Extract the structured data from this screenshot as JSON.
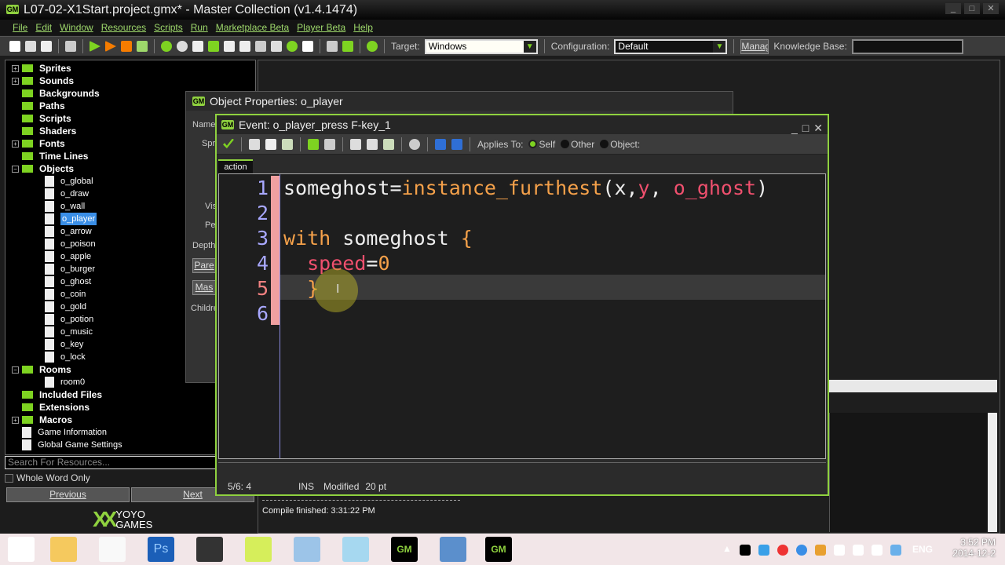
{
  "window": {
    "title": "L07-02-X1Start.project.gmx*  -  Master Collection (v1.4.1474)",
    "controls": [
      "_",
      "□",
      "✕"
    ]
  },
  "menu": [
    "File",
    "Edit",
    "Window",
    "Resources",
    "Scripts",
    "Run",
    "Marketplace Beta",
    "Player Beta",
    "Help"
  ],
  "toolbar": {
    "target_label": "Target:",
    "target_value": "Windows",
    "config_label": "Configuration:",
    "config_value": "Default",
    "manage_label": "Manag",
    "kb_label": "Knowledge Base:",
    "kb_value": ""
  },
  "tree": [
    {
      "label": "Sprites",
      "expand": "+"
    },
    {
      "label": "Sounds",
      "expand": "+"
    },
    {
      "label": "Backgrounds"
    },
    {
      "label": "Paths"
    },
    {
      "label": "Scripts"
    },
    {
      "label": "Shaders"
    },
    {
      "label": "Fonts",
      "expand": "+"
    },
    {
      "label": "Time Lines"
    },
    {
      "label": "Objects",
      "expand": "−",
      "children": [
        "o_global",
        "o_draw",
        "o_wall",
        "o_player",
        "o_arrow",
        "o_poison",
        "o_apple",
        "o_burger",
        "o_ghost",
        "o_coin",
        "o_gold",
        "o_potion",
        "o_music",
        "o_key",
        "o_lock"
      ],
      "selected": "o_player"
    },
    {
      "label": "Rooms",
      "expand": "−",
      "children": [
        "room0"
      ]
    },
    {
      "label": "Included Files"
    },
    {
      "label": "Extensions"
    },
    {
      "label": "Macros",
      "expand": "+"
    }
  ],
  "tree_leaves": [
    "Game Information",
    "Global Game Settings"
  ],
  "search": {
    "placeholder": "Search For Resources..."
  },
  "whole_word": "Whole Word Only",
  "nav": {
    "previous": "Previous",
    "next": "Next"
  },
  "logo": {
    "line1": "YOYO",
    "line2": "GAMES"
  },
  "object_props": {
    "title": "Object Properties: o_player",
    "labels": [
      "Name",
      "Spr",
      "Vis",
      "Pe",
      "Depth",
      "Pare",
      "Mas",
      "Childre"
    ]
  },
  "event": {
    "title": "Event: o_player_press F-key_1",
    "applies_to": "Applies To:",
    "self": "Self",
    "other": "Other",
    "object": "Object:",
    "tab": "action",
    "lines": [
      [
        {
          "t": "someghost=",
          "c": ""
        },
        {
          "t": "instance_furthest",
          "c": "fn"
        },
        {
          "t": "(x,",
          "c": ""
        },
        {
          "t": "y",
          "c": "var"
        },
        {
          "t": ", ",
          "c": ""
        },
        {
          "t": "o_ghost",
          "c": "var"
        },
        {
          "t": ")",
          "c": ""
        }
      ],
      [],
      [
        {
          "t": "with",
          "c": "kw"
        },
        {
          "t": " someghost ",
          "c": ""
        },
        {
          "t": "{",
          "c": "kw"
        }
      ],
      [
        {
          "t": "  ",
          "c": ""
        },
        {
          "t": "speed",
          "c": "var"
        },
        {
          "t": "=",
          "c": ""
        },
        {
          "t": "0",
          "c": "num"
        }
      ],
      [
        {
          "t": "  ",
          "c": ""
        },
        {
          "t": "}",
          "c": "kw"
        }
      ],
      []
    ],
    "current_line": 5,
    "status": {
      "pos": "5/6:  4",
      "mode": "INS",
      "modified": "Modified",
      "size": "20 pt"
    }
  },
  "compile": {
    "message": "Compile finished: 3:31:22 PM"
  },
  "taskbar": {
    "app_ps": "Ps",
    "lang": "ENG",
    "time": "3:52 PM",
    "date": "2014-12-2"
  },
  "colors": {
    "accent": "#8fd13f",
    "keyword": "#f5a14a",
    "variable": "#f0506e",
    "line_number": "#a8a8ff"
  }
}
